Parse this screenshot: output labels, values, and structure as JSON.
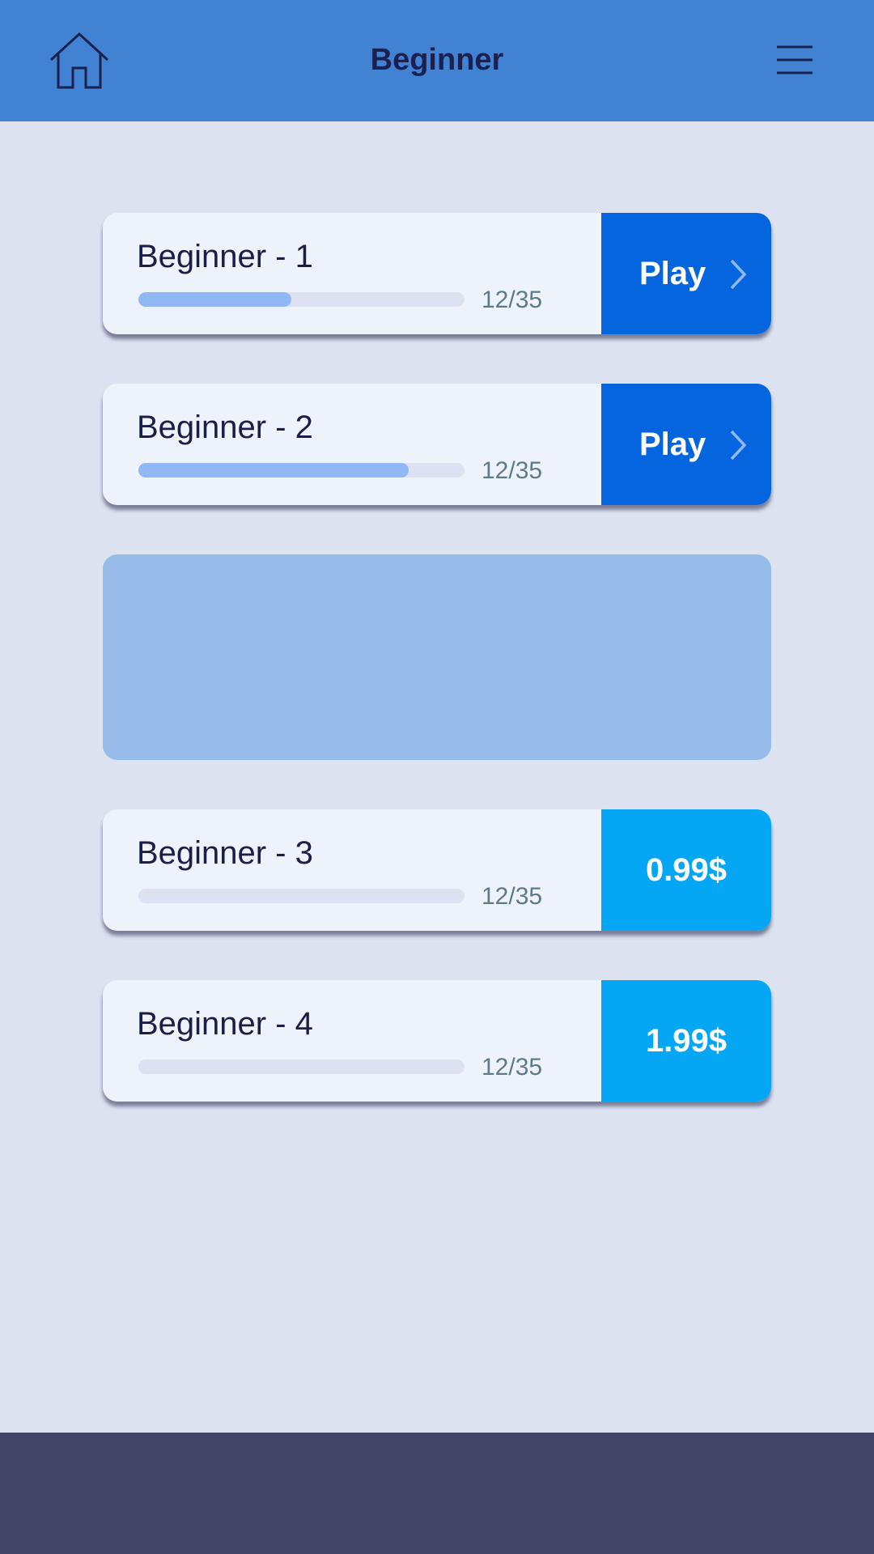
{
  "header": {
    "title": "Beginner",
    "home_icon": "home-icon",
    "menu_icon": "hamburger-menu-icon"
  },
  "levels": [
    {
      "title": "Beginner - 1",
      "progress_text": "12/35",
      "progress_fraction": 0.47,
      "action": {
        "type": "play",
        "label": "Play",
        "icon": "chevron-right-icon"
      }
    },
    {
      "title": "Beginner - 2",
      "progress_text": "12/35",
      "progress_fraction": 0.83,
      "action": {
        "type": "play",
        "label": "Play",
        "icon": "chevron-right-icon"
      }
    },
    {
      "title": "Beginner - 3",
      "progress_text": "12/35",
      "progress_fraction": 0,
      "action": {
        "type": "buy",
        "label": "0.99$"
      }
    },
    {
      "title": "Beginner - 4",
      "progress_text": "12/35",
      "progress_fraction": 0,
      "action": {
        "type": "buy",
        "label": "1.99$"
      }
    }
  ],
  "colors": {
    "header": "#4282d2",
    "background": "#dce2f0",
    "card": "#eef2fa",
    "play_button": "#0565de",
    "buy_button": "#05a7f5",
    "progress_fill": "#8fb8f4",
    "progress_track": "#dce2f2",
    "banner": "#98bce9",
    "footer": "#404467"
  }
}
